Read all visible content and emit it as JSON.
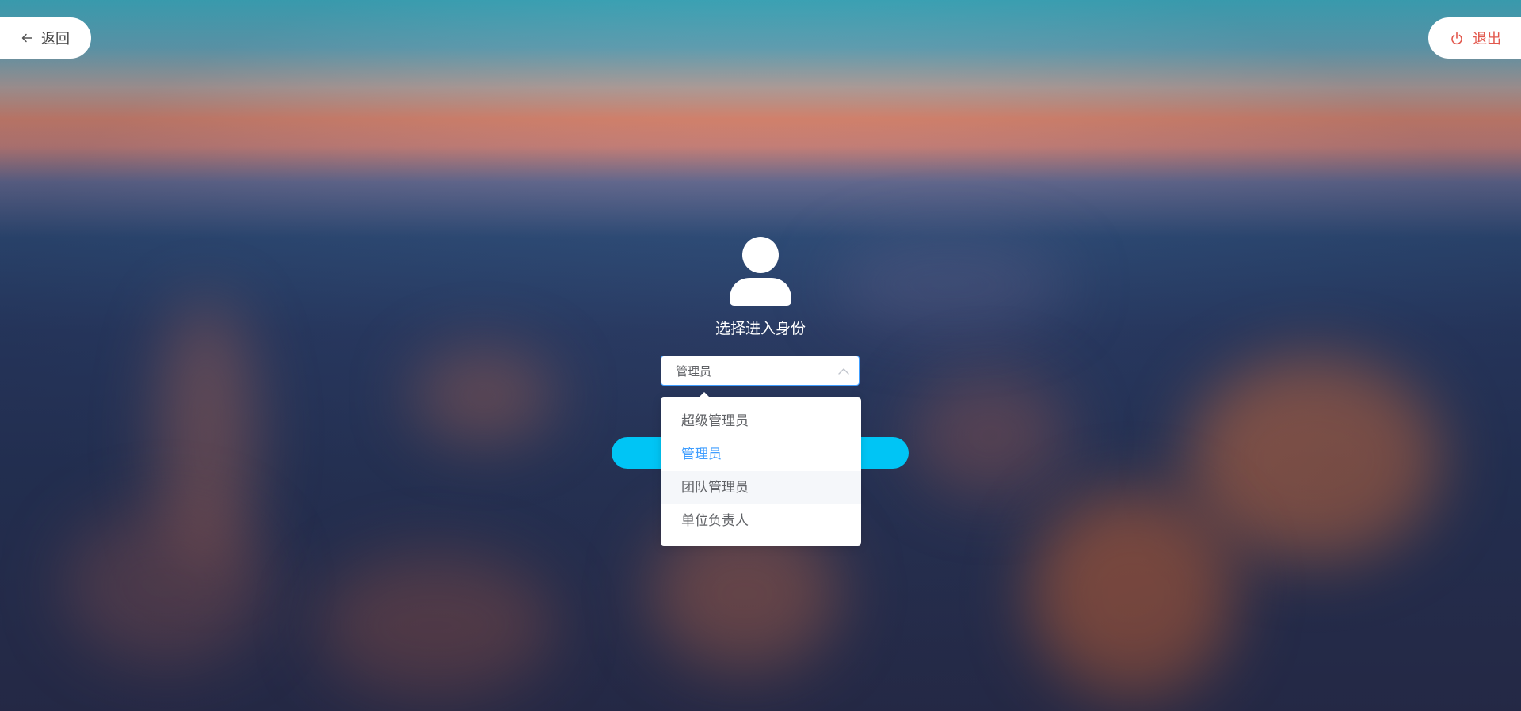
{
  "header": {
    "back_label": "返回",
    "exit_label": "退出"
  },
  "identity": {
    "title": "选择进入身份",
    "selected_value": "管理员",
    "options": [
      {
        "label": "超级管理员",
        "state": "normal"
      },
      {
        "label": "管理员",
        "state": "selected"
      },
      {
        "label": "团队管理员",
        "state": "hover"
      },
      {
        "label": "单位负责人",
        "state": "normal"
      }
    ]
  },
  "colors": {
    "accent": "#409eff",
    "enter_button": "#00c5f5",
    "exit_text": "#e2574c"
  },
  "icons": {
    "back": "arrow-left-icon",
    "exit": "power-icon",
    "avatar": "user-icon",
    "select_arrow": "chevron-up-icon"
  }
}
